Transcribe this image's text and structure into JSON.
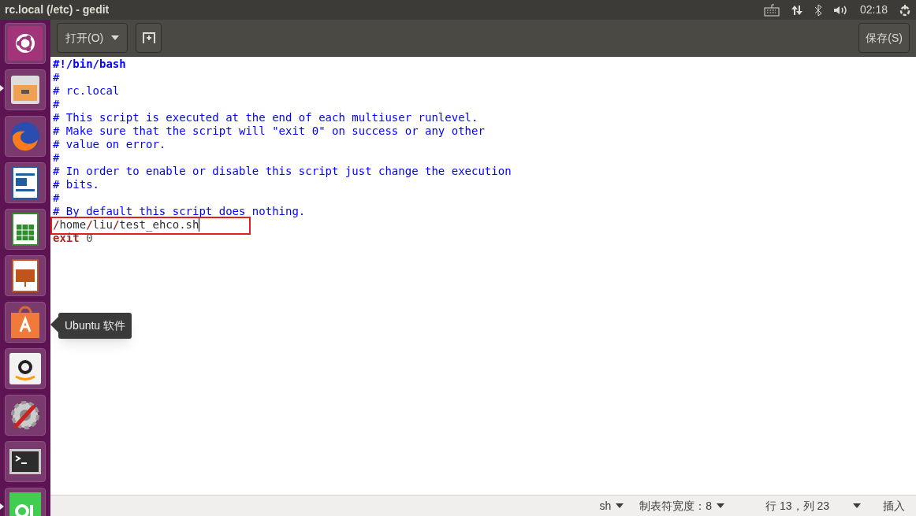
{
  "top_bar": {
    "title": "rc.local (/etc) - gedit",
    "clock": "02:18"
  },
  "launcher": [
    {
      "kind": "ubuntu",
      "running": false
    },
    {
      "kind": "files",
      "running": true
    },
    {
      "kind": "firefox",
      "running": false
    },
    {
      "kind": "writer",
      "running": false
    },
    {
      "kind": "calc",
      "running": false
    },
    {
      "kind": "impress",
      "running": false
    },
    {
      "kind": "software",
      "running": false
    },
    {
      "kind": "amazon",
      "running": false
    },
    {
      "kind": "settings",
      "running": false
    },
    {
      "kind": "terminal",
      "running": false
    },
    {
      "kind": "qt",
      "running": true
    }
  ],
  "tooltip": "Ubuntu 软件",
  "toolbar": {
    "open_button": "打开(O)",
    "save_button": "保存(S)"
  },
  "editor": {
    "lines": [
      {
        "highlighted": false,
        "cursor": false,
        "segments": [
          {
            "text": "#!/bin/bash",
            "kind": "shebang"
          }
        ]
      },
      {
        "highlighted": false,
        "cursor": false,
        "segments": [
          {
            "text": "#",
            "kind": "comment"
          }
        ]
      },
      {
        "highlighted": false,
        "cursor": false,
        "segments": [
          {
            "text": "# rc.local",
            "kind": "comment"
          }
        ]
      },
      {
        "highlighted": false,
        "cursor": false,
        "segments": [
          {
            "text": "#",
            "kind": "comment"
          }
        ]
      },
      {
        "highlighted": false,
        "cursor": false,
        "segments": [
          {
            "text": "# This script is executed at the end of each multiuser runlevel.",
            "kind": "comment"
          }
        ]
      },
      {
        "highlighted": false,
        "cursor": false,
        "segments": [
          {
            "text": "# Make sure that the script will \"exit 0\" on success or any other",
            "kind": "comment"
          }
        ]
      },
      {
        "highlighted": false,
        "cursor": false,
        "segments": [
          {
            "text": "# value on error.",
            "kind": "comment"
          }
        ]
      },
      {
        "highlighted": false,
        "cursor": false,
        "segments": [
          {
            "text": "#",
            "kind": "comment"
          }
        ]
      },
      {
        "highlighted": false,
        "cursor": false,
        "segments": [
          {
            "text": "# In order to enable or disable this script just change the execution",
            "kind": "comment"
          }
        ]
      },
      {
        "highlighted": false,
        "cursor": false,
        "segments": [
          {
            "text": "# bits.",
            "kind": "comment"
          }
        ]
      },
      {
        "highlighted": false,
        "cursor": false,
        "segments": [
          {
            "text": "#",
            "kind": "comment"
          }
        ]
      },
      {
        "highlighted": false,
        "cursor": false,
        "segments": [
          {
            "text": "# By default this script does nothing.",
            "kind": "comment"
          }
        ]
      },
      {
        "highlighted": true,
        "cursor": true,
        "segments": [
          {
            "text": "/",
            "kind": "operator"
          },
          {
            "text": "home",
            "kind": "plain"
          },
          {
            "text": "/",
            "kind": "operator"
          },
          {
            "text": "liu",
            "kind": "plain"
          },
          {
            "text": "/",
            "kind": "operator"
          },
          {
            "text": "test_ehco.sh",
            "kind": "plain"
          }
        ]
      },
      {
        "highlighted": false,
        "cursor": false,
        "segments": [
          {
            "text": "exit",
            "kind": "keyword"
          },
          {
            "text": " 0",
            "kind": "number"
          }
        ]
      }
    ]
  },
  "status_bar": [
    {
      "text": "sh",
      "dropdown": true
    },
    {
      "text": "制表符宽度：8",
      "dropdown": true
    },
    {
      "text": "行 13，列 23",
      "dropdown": false
    },
    {
      "dropdown": true
    },
    {
      "text": "插入",
      "dropdown": false
    }
  ]
}
